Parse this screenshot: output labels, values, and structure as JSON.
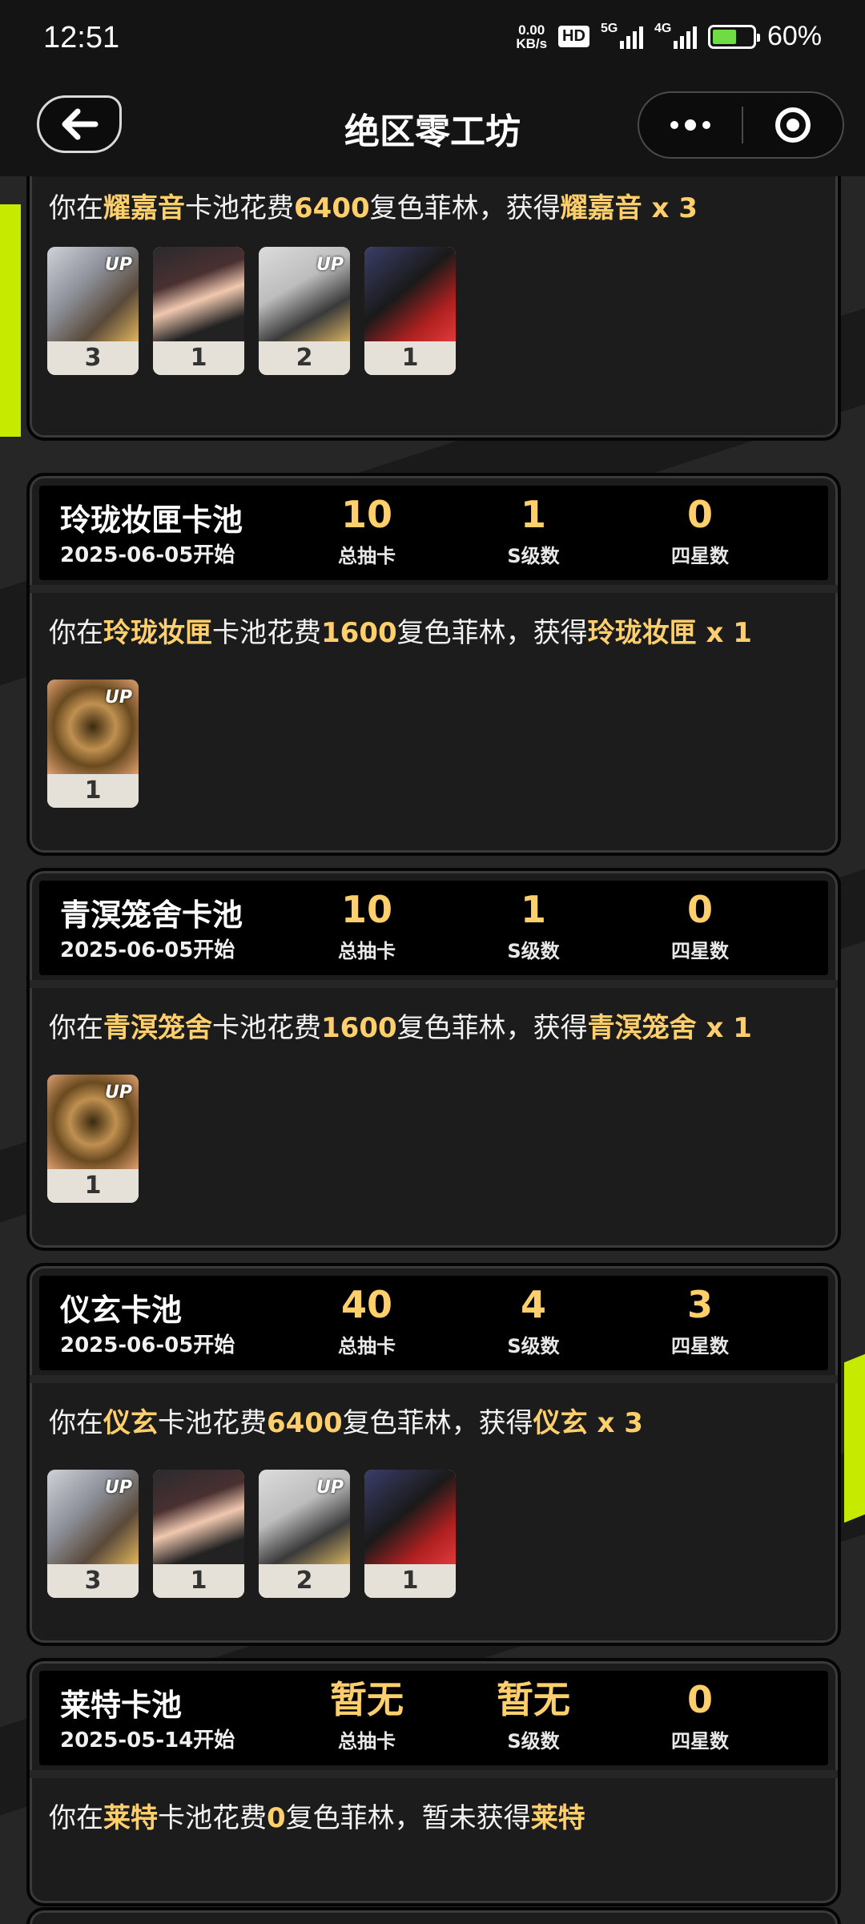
{
  "status_bar": {
    "time": "12:51",
    "net_speed_value": "0.00",
    "net_speed_unit": "KB/s",
    "hd_label": "HD",
    "signal1_label": "5G",
    "signal2_label": "4G",
    "battery_percent": "60%",
    "battery_level": 0.6
  },
  "nav": {
    "back_icon": "arrow-left-icon",
    "title": "绝区零工坊",
    "more_icon": "more-dots-icon",
    "close_icon": "target-circle-icon"
  },
  "cards": [
    {
      "summary": {
        "pre": "你在",
        "pool": "耀嘉音",
        "mid": "卡池花费",
        "cost": "6400",
        "post": "复色菲林，获得",
        "result": "耀嘉音 x 3"
      },
      "items": [
        {
          "count": "3",
          "up": "UP"
        },
        {
          "count": "1",
          "up": ""
        },
        {
          "count": "2",
          "up": "UP"
        },
        {
          "count": "1",
          "up": ""
        }
      ]
    },
    {
      "name": "玲珑妆匣卡池",
      "date": "2025-06-05开始",
      "total_pulls": "10",
      "total_label": "总抽卡",
      "s_count": "1",
      "s_label": "S级数",
      "four_star": "0",
      "four_label": "四星数",
      "summary": {
        "pre": "你在",
        "pool": "玲珑妆匣",
        "mid": "卡池花费",
        "cost": "1600",
        "post": "复色菲林，获得",
        "result": "玲珑妆匣 x 1"
      },
      "items": [
        {
          "count": "1",
          "up": "UP"
        }
      ]
    },
    {
      "name": "青溟笼舍卡池",
      "date": "2025-06-05开始",
      "total_pulls": "10",
      "total_label": "总抽卡",
      "s_count": "1",
      "s_label": "S级数",
      "four_star": "0",
      "four_label": "四星数",
      "summary": {
        "pre": "你在",
        "pool": "青溟笼舍",
        "mid": "卡池花费",
        "cost": "1600",
        "post": "复色菲林，获得",
        "result": "青溟笼舍 x 1"
      },
      "items": [
        {
          "count": "1",
          "up": "UP"
        }
      ]
    },
    {
      "name": "仪玄卡池",
      "date": "2025-06-05开始",
      "total_pulls": "40",
      "total_label": "总抽卡",
      "s_count": "4",
      "s_label": "S级数",
      "four_star": "3",
      "four_label": "四星数",
      "summary": {
        "pre": "你在",
        "pool": "仪玄",
        "mid": "卡池花费",
        "cost": "6400",
        "post": "复色菲林，获得",
        "result": "仪玄 x 3"
      },
      "items": [
        {
          "count": "3",
          "up": "UP"
        },
        {
          "count": "1",
          "up": ""
        },
        {
          "count": "2",
          "up": "UP"
        },
        {
          "count": "1",
          "up": ""
        }
      ]
    },
    {
      "name": "莱特卡池",
      "date": "2025-05-14开始",
      "total_pulls": "暂无",
      "total_label": "总抽卡",
      "s_count": "暂无",
      "s_label": "S级数",
      "four_star": "0",
      "four_label": "四星数",
      "summary": {
        "pre": "你在",
        "pool": "莱特",
        "mid": "卡池花费",
        "cost": "0",
        "post": "复色菲林，暂未获得",
        "result": "莱特"
      }
    }
  ]
}
